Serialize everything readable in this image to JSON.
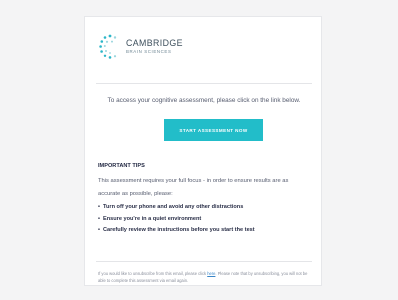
{
  "email": {
    "logo": {
      "line1": "CAMBRIDGE",
      "line2": "BRAIN SCIENCES",
      "icon": "brain-dots-logo-icon",
      "colors": {
        "dots": "#2bb6c8",
        "dots_light": "#9ad6de"
      }
    },
    "intro_text": "To access your cognitive assessment, please click on the link below.",
    "start_button_label": "START ASSESSMENT NOW",
    "tips": {
      "title": "IMPORTANT TIPS",
      "intro": "This assessment requires your full focus - in order to ensure results are as accurate as possible, please:",
      "items": [
        "Turn off your phone and avoid any other distractions",
        "Ensure you're in a quiet environment",
        "Carefully review the instructions before you start the test"
      ]
    },
    "footer": {
      "before_link": "If you would like to unsubscribe from this email, please click ",
      "link_text": "here",
      "after_link": ". Please note that by unsubscribing, you will not be able to complete this assessment via email again."
    },
    "colors": {
      "accent": "#22bdc9",
      "page_background": "#f4f4f5",
      "card_background": "#ffffff",
      "link": "#3a86c8"
    }
  }
}
